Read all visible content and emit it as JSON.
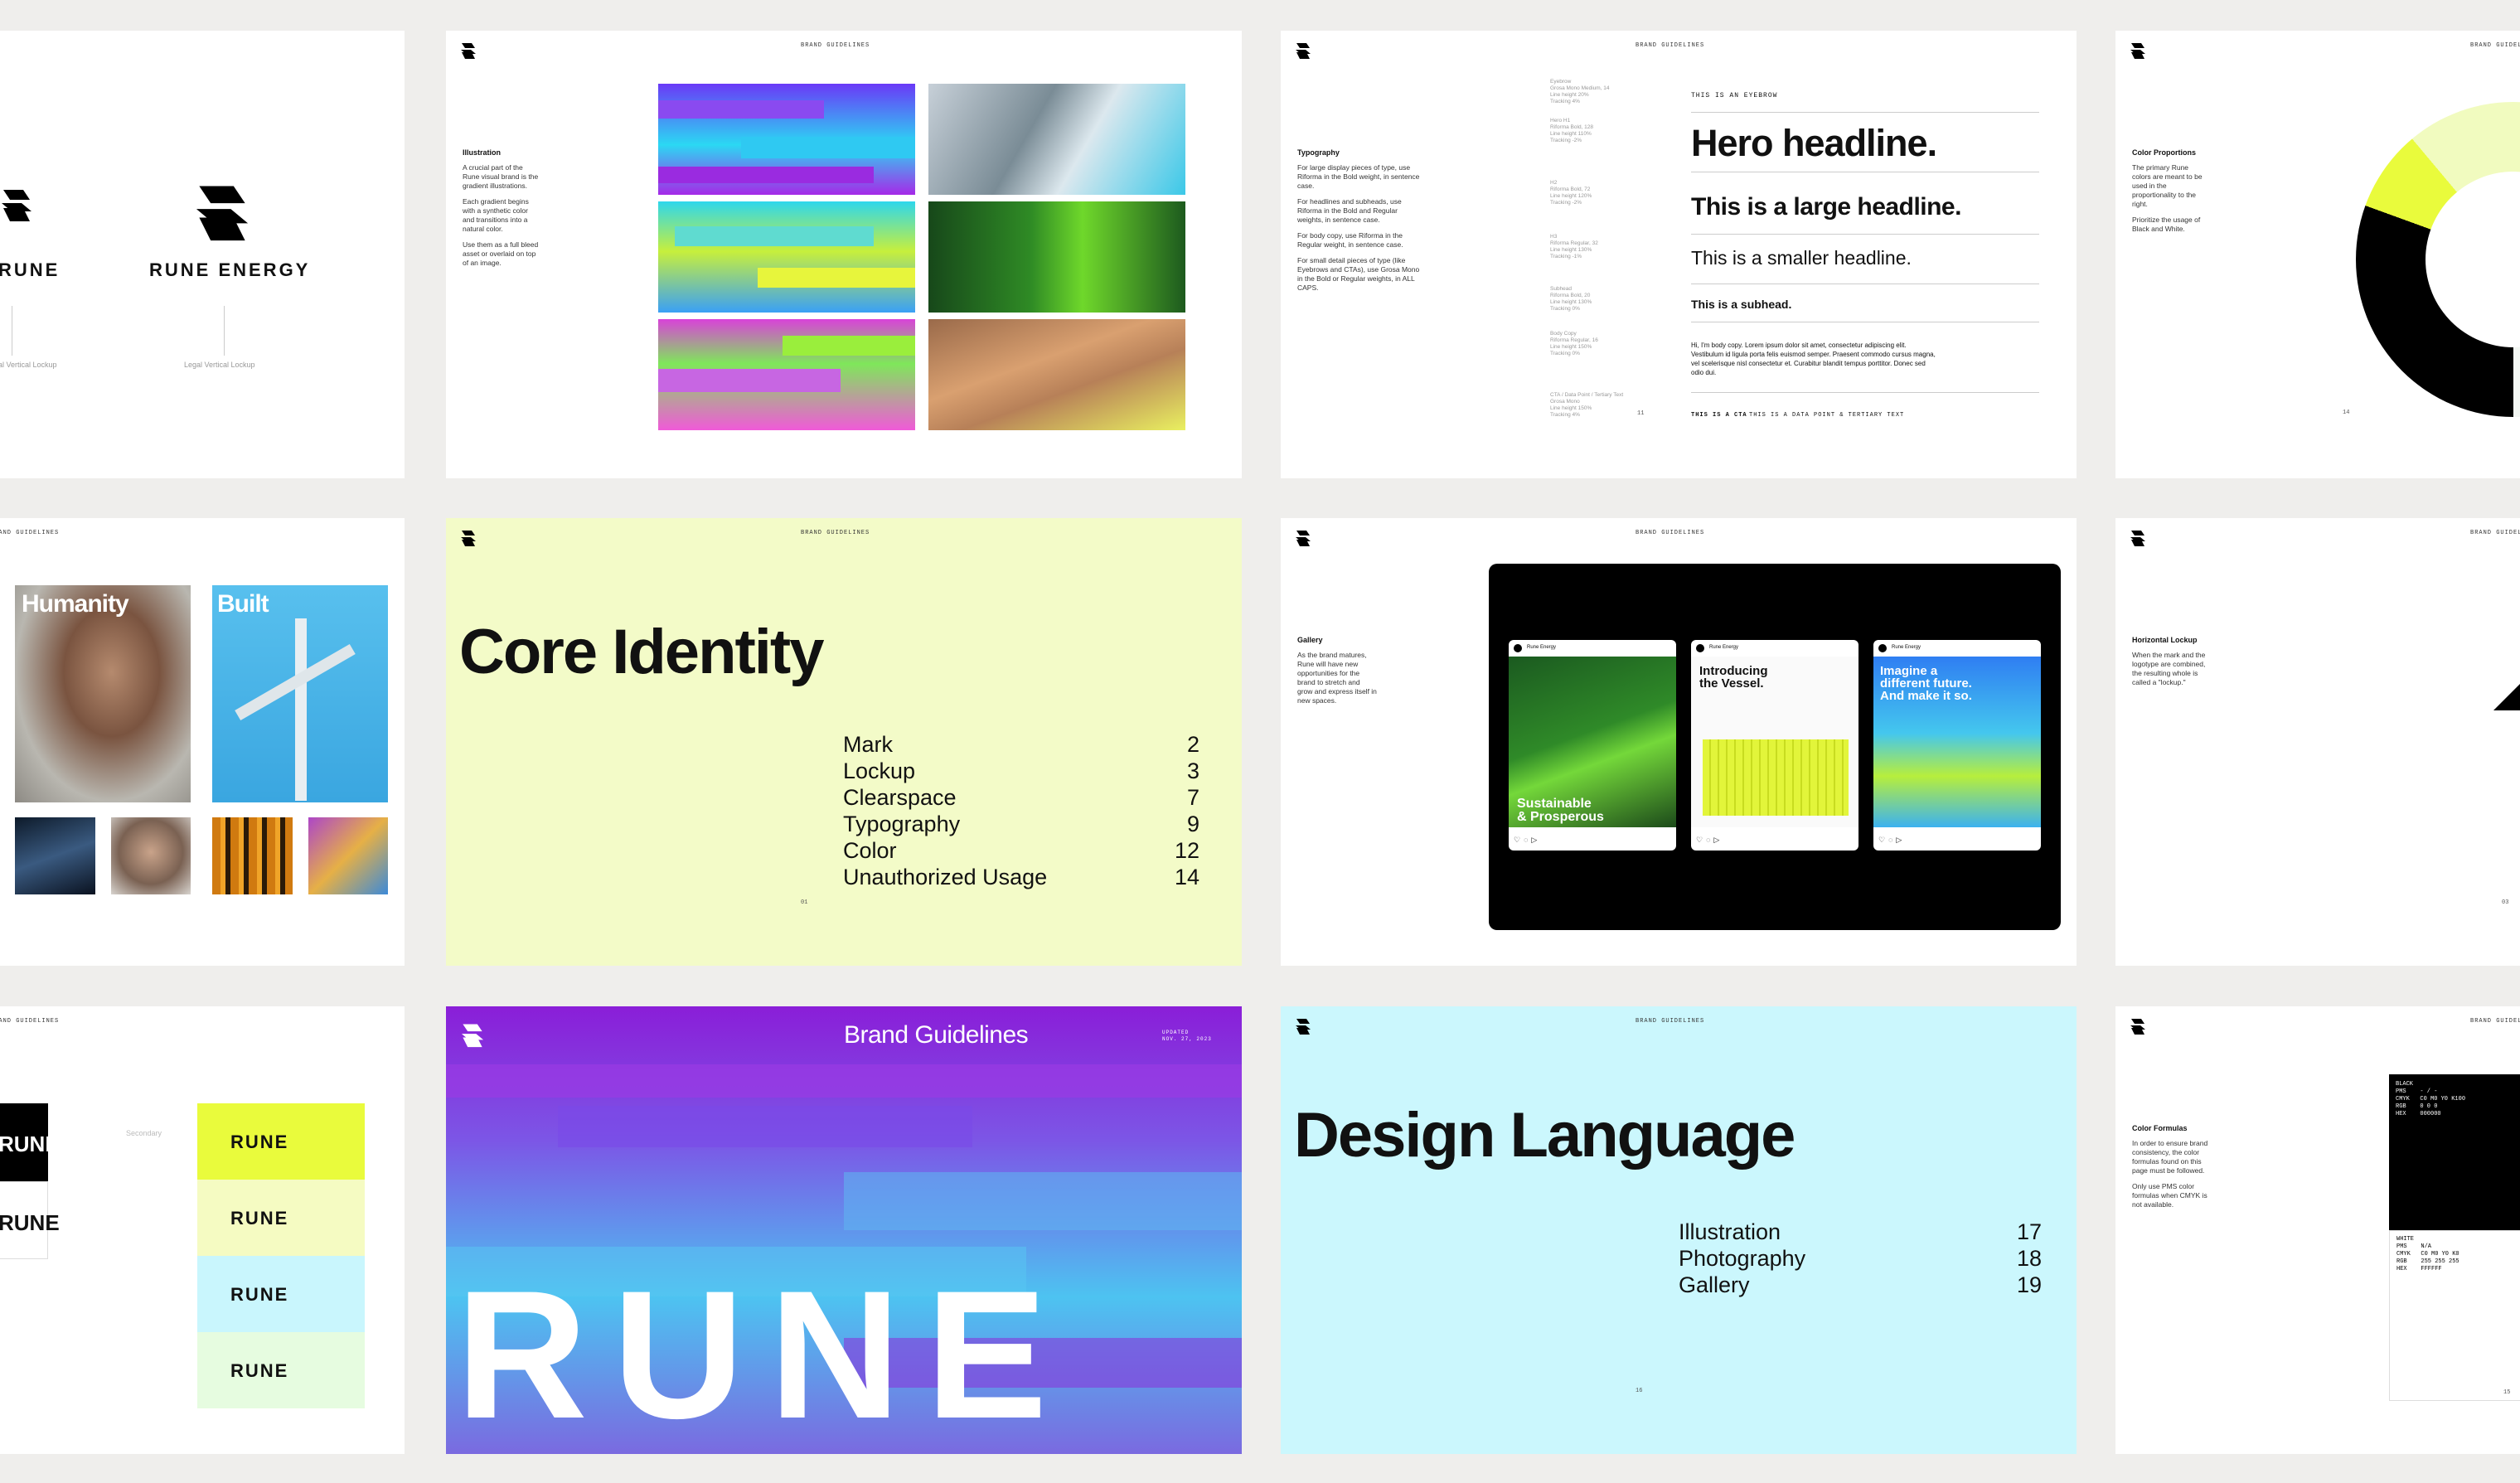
{
  "header": "BRAND GUIDELINES",
  "slide_lockups": {
    "left_word": "RUNE",
    "wordmark": "RUNE ENERGY",
    "left_caption": "al Vertical Lockup",
    "caption": "Legal Vertical Lockup"
  },
  "slide_illustration": {
    "title": "Illustration",
    "desc": [
      "A crucial part of the Rune visual brand is the gradient illustrations.",
      "Each gradient begins with a synthetic color and transitions into a natural color.",
      "Use them as a full bleed asset or overlaid on top of an image."
    ]
  },
  "slide_typography": {
    "title": "Typography",
    "desc": [
      "For large display pieces of type, use Riforma in the Bold weight, in sentence case.",
      "For headlines and subheads, use Riforma in the Bold and Regular weights, in sentence case.",
      "For body copy, use Riforma in the Regular weight, in sentence case.",
      "For small detail pieces of type (like Eyebrows and CTAs), use Grosa Mono in the Bold or Regular weights, in ALL CAPS."
    ],
    "specs": [
      "Eyebrow\nGrosa Mono Medium, 14\nLine height 20%\nTracking 4%",
      "Hero H1\nRiforma Bold, 128\nLine height 110%\nTracking -2%",
      "H2\nRiforma Bold, 72\nLine height 120%\nTracking -2%",
      "H3\nRiforma Regular, 32\nLine height 130%\nTracking -1%",
      "Subhead\nRiforma Bold, 20\nLine height 130%\nTracking 0%",
      "Body Copy\nRiforma Regular, 16\nLine height 150%\nTracking 0%",
      "CTA / Data Point / Tertiary Text\nGrosa Mono\nLine height 150%\nTracking 4%"
    ],
    "eyebrow": "THIS IS AN EYEBROW",
    "hero": "Hero headline.",
    "large": "This is a large headline.",
    "smaller": "This is a smaller headline.",
    "subhead": "This is a subhead.",
    "body": "Hi, I'm body copy. Lorem ipsum dolor sit amet, consectetur adipiscing elit. Vestibulum id ligula porta felis euismod semper. Praesent commodo cursus magna, vel scelerisque nisl consectetur et. Curabitur blandit tempus porttitor. Donec sed odio dui.",
    "cta": "THIS IS A CTA",
    "data_point": "THIS IS A DATA POINT & TERTIARY TEXT",
    "page": "11"
  },
  "slide_color_proportions": {
    "title": "Color Proportions",
    "desc": [
      "The primary Rune colors are meant to be used in the proportionality to the right.",
      "Prioritize the usage of Black and White."
    ],
    "page": "14"
  },
  "slide_photography": {
    "word1": "Humanity",
    "word2": "Built"
  },
  "slide_core_identity": {
    "title": "Core Identity",
    "items": [
      {
        "label": "Mark",
        "page": "2"
      },
      {
        "label": "Lockup",
        "page": "3"
      },
      {
        "label": "Clearspace",
        "page": "7"
      },
      {
        "label": "Typography",
        "page": "9"
      },
      {
        "label": "Color",
        "page": "12"
      },
      {
        "label": "Unauthorized Usage",
        "page": "14"
      }
    ],
    "page": "01"
  },
  "slide_gallery": {
    "title": "Gallery",
    "desc": "As the brand matures, Rune will have new opportunities for the brand to stretch and grow and express itself in new spaces.",
    "posts": [
      {
        "account": "Rune Energy",
        "headline": "Sustainable\n& Prosperous"
      },
      {
        "account": "Rune Energy",
        "headline": "Introducing\nthe Vessel."
      },
      {
        "account": "Rune Energy",
        "headline": "Imagine a\ndifferent future.\nAnd make it so."
      }
    ]
  },
  "slide_horizontal_lockup": {
    "title": "Horizontal Lockup",
    "desc": "When the mark and the logotype are combined, the resulting whole is called a \"lockup.\"",
    "page": "03"
  },
  "slide_secondary": {
    "word": "RUNE",
    "caption": "Secondary",
    "swatches": [
      "#e9fb3c",
      "#f5fbc2",
      "#c9f6fd",
      "#e6fce0"
    ]
  },
  "slide_cover": {
    "title": "Brand Guidelines",
    "updated": "UPDATED\nNOV. 27, 2023",
    "big": "RUNE"
  },
  "slide_design_language": {
    "title": "Design Language",
    "items": [
      {
        "label": "Illustration",
        "page": "17"
      },
      {
        "label": "Photography",
        "page": "18"
      },
      {
        "label": "Gallery",
        "page": "19"
      }
    ],
    "page": "16"
  },
  "slide_color_formulas": {
    "title": "Color Formulas",
    "desc": [
      "In order to ensure brand consistency, the color formulas found on this page must be followed.",
      "Only use PMS color formulas when CMYK is not available."
    ],
    "black": "BLACK\nPMS    - / -\nCMYK   C0 M0 Y0 K100\nRGB    0 0 0\nHEX    000000",
    "white": "WHITE\nPMS    N/A\nCMYK   C0 M0 Y0 K0\nRGB    255 255 255\nHEX    FFFFFF",
    "page": "15"
  },
  "colors": {
    "background": "#efeeec",
    "yellow_green": "#e9fb3c",
    "pale_yellow": "#f3fbc8",
    "pale_cyan": "#cbf7fd",
    "purple": "#8a1ed8",
    "black": "#000000"
  }
}
